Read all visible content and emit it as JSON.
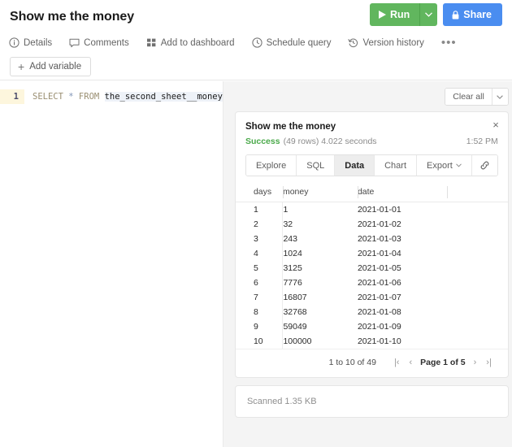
{
  "header": {
    "title": "Show me the money",
    "run_label": "Run",
    "share_label": "Share",
    "toolbar": [
      {
        "label": "Details",
        "icon": "info-circle-icon"
      },
      {
        "label": "Comments",
        "icon": "comment-icon"
      },
      {
        "label": "Add to dashboard",
        "icon": "dashboard-grid-icon"
      },
      {
        "label": "Schedule query",
        "icon": "clock-icon"
      },
      {
        "label": "Version history",
        "icon": "history-icon"
      }
    ],
    "more_label": "•••",
    "add_variable_label": "Add variable"
  },
  "editor": {
    "line_number": "1",
    "keyword_select": "SELECT",
    "star": "*",
    "keyword_from": "FROM",
    "table_name": "the_second_sheet__money"
  },
  "results": {
    "clear_all_label": "Clear all",
    "card_title": "Show me the money",
    "status_word": "Success",
    "status_detail": "(49 rows) 4.022 seconds",
    "timestamp": "1:52 PM",
    "close_label": "×",
    "tabs": [
      {
        "label": "Explore",
        "active": false
      },
      {
        "label": "SQL",
        "active": false
      },
      {
        "label": "Data",
        "active": true
      },
      {
        "label": "Chart",
        "active": false
      },
      {
        "label": "Export",
        "active": false,
        "caret": true
      }
    ],
    "link_icon": "link-icon",
    "table": {
      "columns": [
        "days",
        "money",
        "date",
        ""
      ],
      "rows": [
        [
          "1",
          "1",
          "2021-01-01",
          ""
        ],
        [
          "2",
          "32",
          "2021-01-02",
          ""
        ],
        [
          "3",
          "243",
          "2021-01-03",
          ""
        ],
        [
          "4",
          "1024",
          "2021-01-04",
          ""
        ],
        [
          "5",
          "3125",
          "2021-01-05",
          ""
        ],
        [
          "6",
          "7776",
          "2021-01-06",
          ""
        ],
        [
          "7",
          "16807",
          "2021-01-07",
          ""
        ],
        [
          "8",
          "32768",
          "2021-01-08",
          ""
        ],
        [
          "9",
          "59049",
          "2021-01-09",
          ""
        ],
        [
          "10",
          "100000",
          "2021-01-10",
          ""
        ]
      ]
    },
    "pagination": {
      "range_label": "1 to 10 of 49",
      "first_label": "|‹",
      "prev_label": "‹",
      "page_label": "Page 1 of 5",
      "next_label": "›",
      "last_label": "›|"
    },
    "scanned_label": "Scanned 1.35 KB"
  },
  "colors": {
    "run_green": "#61b65e",
    "share_blue": "#4a8df0",
    "success_green": "#4aa94a",
    "gutter_yellow": "#fdf6dd"
  }
}
